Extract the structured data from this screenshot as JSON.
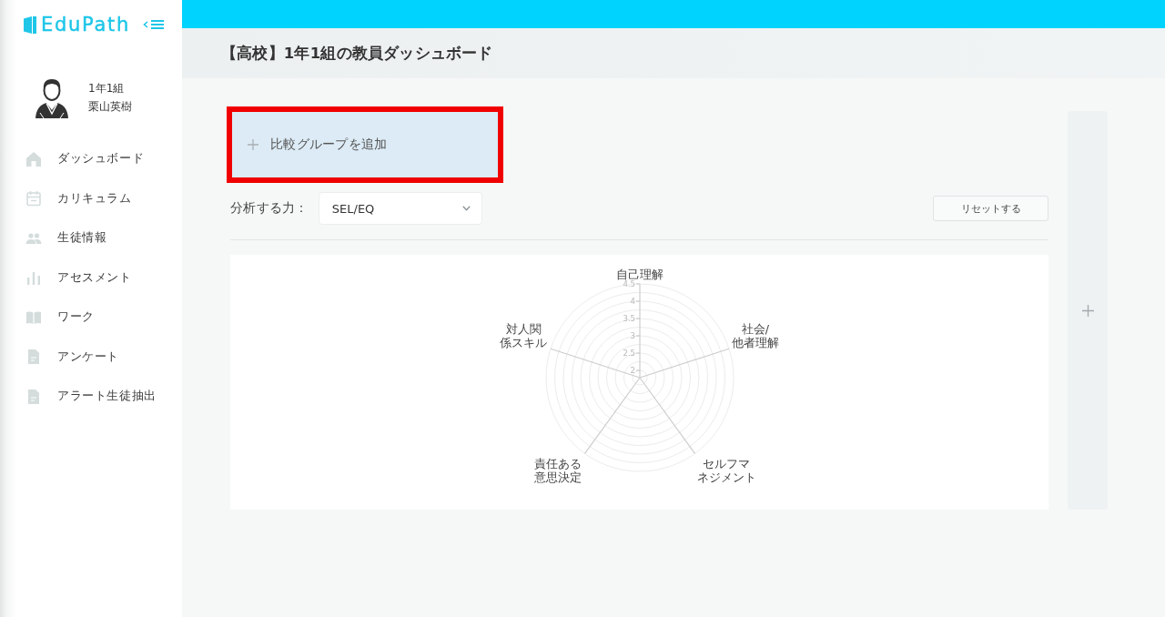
{
  "sidebar": {
    "logo": "EduPath",
    "user": {
      "class_name": "1年1組",
      "name": "栗山英樹"
    },
    "items": [
      {
        "label": "ダッシュボード",
        "selected": false
      },
      {
        "label": "カリキュラム",
        "selected": false
      },
      {
        "label": "生徒情報",
        "selected": false
      },
      {
        "label": "アセスメント",
        "selected": false
      },
      {
        "label": "ワーク",
        "selected": false
      },
      {
        "label": "アンケート",
        "selected": false
      },
      {
        "label": "アラート生徒抽出",
        "selected": false
      }
    ]
  },
  "header": {
    "title": "【高校】1年1組の教員ダッシュボード"
  },
  "compare_group": {
    "label": "比較グループを追加",
    "highlighted": true
  },
  "analysis": {
    "label": "分析する力：",
    "select": {
      "value": "SEL/EQ"
    },
    "reset_button": "リセットする"
  },
  "radar_chart": {
    "axes": [
      {
        "lines": [
          "自己理解"
        ]
      },
      {
        "lines": [
          "対人関",
          "係スキル"
        ]
      },
      {
        "lines": [
          "社会/",
          "他者理解"
        ]
      },
      {
        "lines": [
          "責任ある",
          "意思決定"
        ]
      },
      {
        "lines": [
          "セルフマ",
          "ネジメント"
        ]
      }
    ],
    "ticks": [
      "4.5",
      "4",
      "3.5",
      "3",
      "2.5",
      "2"
    ]
  }
}
